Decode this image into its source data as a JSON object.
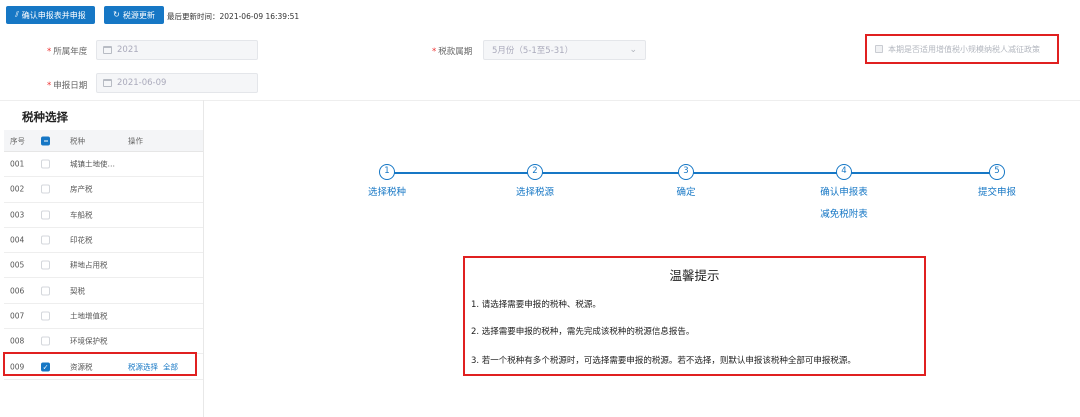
{
  "toolbar": {
    "confirm_label": "确认申报表并申报",
    "confirm_icon": "chart-icon",
    "update_label": "税源更新",
    "update_icon": "refresh-icon",
    "update_time": "最后更新时间：2021-06-09 16:39:51"
  },
  "form": {
    "year_label": "所属年度",
    "year_value": "2021",
    "period_label": "税款属期",
    "period_value": "5月份（5-1至5-31）",
    "date_label": "申报日期",
    "date_value": "2021-06-09",
    "policy_label": "本期是否适用增值税小规模纳税人减征政策"
  },
  "left": {
    "title": "税种选择",
    "headers": {
      "no": "序号",
      "name": "税种",
      "op": "操作"
    },
    "rows": [
      {
        "no": "001",
        "name": "城镇土地使…",
        "checked": false
      },
      {
        "no": "002",
        "name": "房产税",
        "checked": false
      },
      {
        "no": "003",
        "name": "车船税",
        "checked": false
      },
      {
        "no": "004",
        "name": "印花税",
        "checked": false
      },
      {
        "no": "005",
        "name": "耕地占用税",
        "checked": false
      },
      {
        "no": "006",
        "name": "契税",
        "checked": false
      },
      {
        "no": "007",
        "name": "土地增值税",
        "checked": false
      },
      {
        "no": "008",
        "name": "环境保护税",
        "checked": false
      },
      {
        "no": "009",
        "name": "资源税",
        "checked": true,
        "op_select": "税源选择",
        "op_all": "全部"
      }
    ]
  },
  "steps": [
    {
      "num": "1",
      "label": "选择税种"
    },
    {
      "num": "2",
      "label": "选择税源"
    },
    {
      "num": "3",
      "label": "确定"
    },
    {
      "num": "4",
      "label": "确认申报表",
      "sub": "减免税附表"
    },
    {
      "num": "5",
      "label": "提交申报"
    }
  ],
  "tips": {
    "title": "温馨提示",
    "items": [
      "1. 请选择需要申报的税种、税源。",
      "2. 选择需要申报的税种，需先完成该税种的税源信息报告。",
      "3. 若一个税种有多个税源时，可选择需要申报的税源。若不选择，则默认申报该税种全部可申报税源。"
    ]
  },
  "colors": {
    "primary": "#1677c5",
    "highlight_border": "#e02020"
  }
}
